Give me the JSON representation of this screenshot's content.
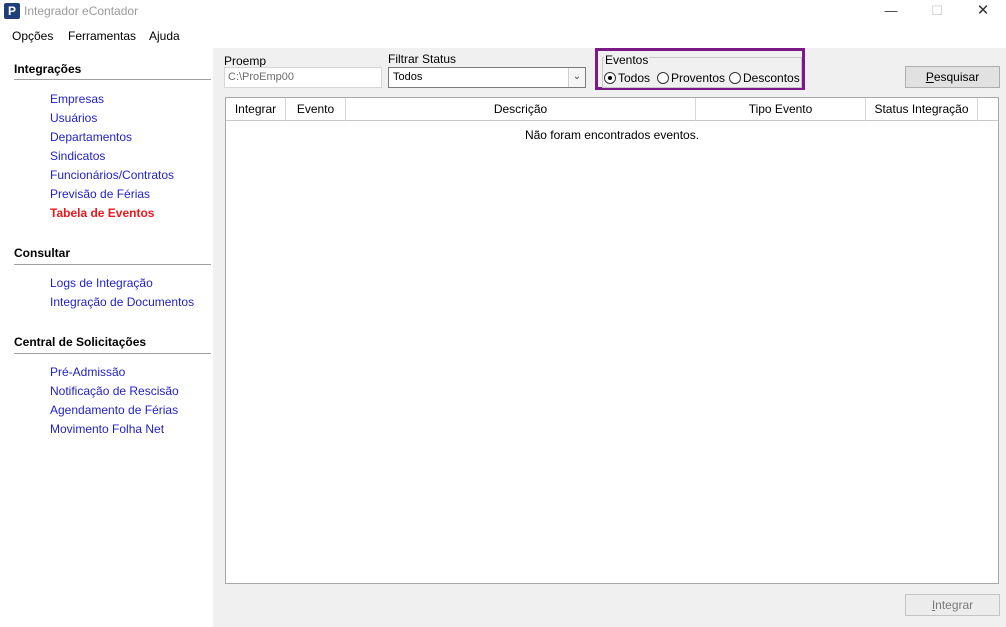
{
  "window": {
    "title": "Integrador eContador",
    "icon_letter": "P",
    "controls": {
      "minimize": "—",
      "maximize": "☐",
      "close": "✕"
    }
  },
  "menu": [
    "Opções",
    "Ferramentas",
    "Ajuda"
  ],
  "sidebar": {
    "sections": [
      {
        "title": "Integrações",
        "items": [
          "Empresas",
          "Usuários",
          "Departamentos",
          "Sindicatos",
          "Funcionários/Contratos",
          "Previsão de Férias",
          "Tabela de Eventos"
        ],
        "active": "Tabela de Eventos"
      },
      {
        "title": "Consultar",
        "items": [
          "Logs de Integração",
          "Integração de Documentos"
        ]
      },
      {
        "title": "Central de Solicitações",
        "items": [
          "Pré-Admissão",
          "Notificação de Rescisão",
          "Agendamento de Férias",
          "Movimento Folha Net"
        ]
      }
    ]
  },
  "filters": {
    "proemp_label": "Proemp",
    "proemp_value": "C:\\ProEmp00",
    "status_label": "Filtrar Status",
    "status_value": "Todos",
    "eventos_label": "Eventos",
    "eventos_options": [
      "Todos",
      "Proventos",
      "Descontos"
    ],
    "eventos_selected": "Todos",
    "search_button": "Pesquisar"
  },
  "grid": {
    "columns": [
      "Integrar",
      "Evento",
      "Descrição",
      "Tipo Evento",
      "Status Integração"
    ],
    "empty_message": "Não foram encontrados eventos."
  },
  "footer": {
    "integrate_button": "Integrar"
  },
  "colors": {
    "link": "#1f1fc8",
    "active_link": "#e8191c",
    "highlight_border": "#7b1a86"
  }
}
